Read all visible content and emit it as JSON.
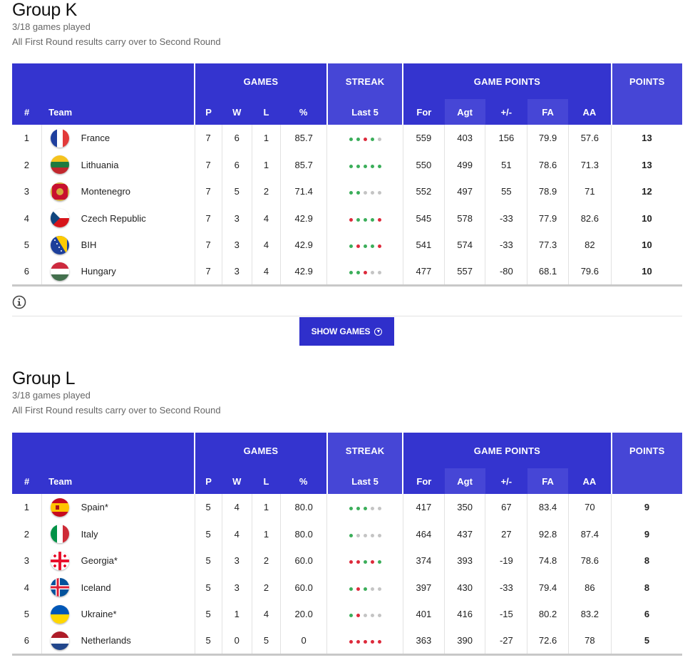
{
  "groups": [
    {
      "title": "Group K",
      "played": "3/18 games played",
      "note": "All First Round results carry over to Second Round",
      "headers": {
        "games": "GAMES",
        "streak": "STREAK",
        "game_points": "GAME POINTS",
        "points": "POINTS",
        "rank": "#",
        "team": "Team",
        "p": "P",
        "w": "W",
        "l": "L",
        "pct": "%",
        "last5": "Last 5",
        "for": "For",
        "agt": "Agt",
        "diff": "+/-",
        "fa": "FA",
        "aa": "AA"
      },
      "rows": [
        {
          "rank": "1",
          "team": "France",
          "flag": "france",
          "p": "7",
          "w": "6",
          "l": "1",
          "pct": "85.7",
          "streak": [
            "W",
            "W",
            "L",
            "W",
            "N"
          ],
          "for": "559",
          "agt": "403",
          "diff": "156",
          "fa": "79.9",
          "aa": "57.6",
          "pts": "13"
        },
        {
          "rank": "2",
          "team": "Lithuania",
          "flag": "lithuania",
          "p": "7",
          "w": "6",
          "l": "1",
          "pct": "85.7",
          "streak": [
            "W",
            "W",
            "W",
            "W",
            "W"
          ],
          "for": "550",
          "agt": "499",
          "diff": "51",
          "fa": "78.6",
          "aa": "71.3",
          "pts": "13"
        },
        {
          "rank": "3",
          "team": "Montenegro",
          "flag": "montenegro",
          "p": "7",
          "w": "5",
          "l": "2",
          "pct": "71.4",
          "streak": [
            "W",
            "W",
            "N",
            "N",
            "N"
          ],
          "for": "552",
          "agt": "497",
          "diff": "55",
          "fa": "78.9",
          "aa": "71",
          "pts": "12"
        },
        {
          "rank": "4",
          "team": "Czech Republic",
          "flag": "czech",
          "p": "7",
          "w": "3",
          "l": "4",
          "pct": "42.9",
          "streak": [
            "L",
            "W",
            "W",
            "W",
            "L"
          ],
          "for": "545",
          "agt": "578",
          "diff": "-33",
          "fa": "77.9",
          "aa": "82.6",
          "pts": "10"
        },
        {
          "rank": "5",
          "team": "BIH",
          "flag": "bih",
          "p": "7",
          "w": "3",
          "l": "4",
          "pct": "42.9",
          "streak": [
            "W",
            "L",
            "W",
            "W",
            "L"
          ],
          "for": "541",
          "agt": "574",
          "diff": "-33",
          "fa": "77.3",
          "aa": "82",
          "pts": "10"
        },
        {
          "rank": "6",
          "team": "Hungary",
          "flag": "hungary",
          "p": "7",
          "w": "3",
          "l": "4",
          "pct": "42.9",
          "streak": [
            "W",
            "W",
            "L",
            "N",
            "N"
          ],
          "for": "477",
          "agt": "557",
          "diff": "-80",
          "fa": "68.1",
          "aa": "79.6",
          "pts": "10"
        }
      ]
    },
    {
      "title": "Group L",
      "played": "3/18 games played",
      "note": "All First Round results carry over to Second Round",
      "headers": {
        "games": "GAMES",
        "streak": "STREAK",
        "game_points": "GAME POINTS",
        "points": "POINTS",
        "rank": "#",
        "team": "Team",
        "p": "P",
        "w": "W",
        "l": "L",
        "pct": "%",
        "last5": "Last 5",
        "for": "For",
        "agt": "Agt",
        "diff": "+/-",
        "fa": "FA",
        "aa": "AA"
      },
      "rows": [
        {
          "rank": "1",
          "team": "Spain*",
          "flag": "spain",
          "p": "5",
          "w": "4",
          "l": "1",
          "pct": "80.0",
          "streak": [
            "W",
            "W",
            "W",
            "N",
            "N"
          ],
          "for": "417",
          "agt": "350",
          "diff": "67",
          "fa": "83.4",
          "aa": "70",
          "pts": "9"
        },
        {
          "rank": "2",
          "team": "Italy",
          "flag": "italy",
          "p": "5",
          "w": "4",
          "l": "1",
          "pct": "80.0",
          "streak": [
            "W",
            "N",
            "N",
            "N",
            "N"
          ],
          "for": "464",
          "agt": "437",
          "diff": "27",
          "fa": "92.8",
          "aa": "87.4",
          "pts": "9"
        },
        {
          "rank": "3",
          "team": "Georgia*",
          "flag": "georgia",
          "p": "5",
          "w": "3",
          "l": "2",
          "pct": "60.0",
          "streak": [
            "L",
            "L",
            "W",
            "L",
            "W"
          ],
          "for": "374",
          "agt": "393",
          "diff": "-19",
          "fa": "74.8",
          "aa": "78.6",
          "pts": "8"
        },
        {
          "rank": "4",
          "team": "Iceland",
          "flag": "iceland",
          "p": "5",
          "w": "3",
          "l": "2",
          "pct": "60.0",
          "streak": [
            "W",
            "L",
            "W",
            "N",
            "N"
          ],
          "for": "397",
          "agt": "430",
          "diff": "-33",
          "fa": "79.4",
          "aa": "86",
          "pts": "8"
        },
        {
          "rank": "5",
          "team": "Ukraine*",
          "flag": "ukraine",
          "p": "5",
          "w": "1",
          "l": "4",
          "pct": "20.0",
          "streak": [
            "W",
            "L",
            "N",
            "N",
            "N"
          ],
          "for": "401",
          "agt": "416",
          "diff": "-15",
          "fa": "80.2",
          "aa": "83.2",
          "pts": "6"
        },
        {
          "rank": "6",
          "team": "Netherlands",
          "flag": "netherlands",
          "p": "5",
          "w": "0",
          "l": "5",
          "pct": "0",
          "streak": [
            "L",
            "L",
            "L",
            "L",
            "L"
          ],
          "for": "363",
          "agt": "390",
          "diff": "-27",
          "fa": "72.6",
          "aa": "78",
          "pts": "5"
        }
      ]
    }
  ],
  "show_games": {
    "label": "SHOW GAMES",
    "icon": "chevron-down-circle-icon"
  },
  "info_icon": "info-icon",
  "colors": {
    "header": "#3434cf",
    "header_alt": "#4646d6",
    "win": "#3bae5a",
    "loss": "#dd2a3b",
    "none": "#c4c4c4"
  }
}
